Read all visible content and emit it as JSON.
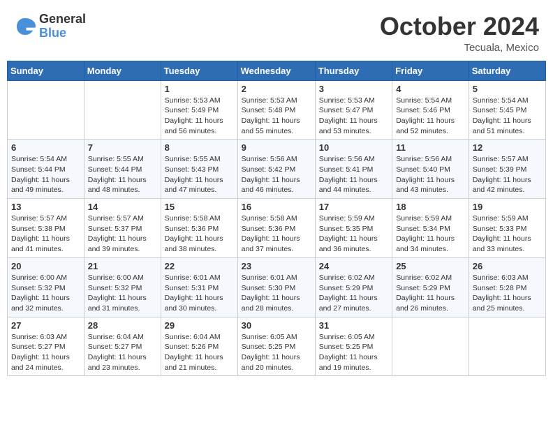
{
  "header": {
    "logo_line1": "General",
    "logo_line2": "Blue",
    "month": "October 2024",
    "location": "Tecuala, Mexico"
  },
  "weekdays": [
    "Sunday",
    "Monday",
    "Tuesday",
    "Wednesday",
    "Thursday",
    "Friday",
    "Saturday"
  ],
  "weeks": [
    [
      {
        "day": "",
        "info": ""
      },
      {
        "day": "",
        "info": ""
      },
      {
        "day": "1",
        "info": "Sunrise: 5:53 AM\nSunset: 5:49 PM\nDaylight: 11 hours and 56 minutes."
      },
      {
        "day": "2",
        "info": "Sunrise: 5:53 AM\nSunset: 5:48 PM\nDaylight: 11 hours and 55 minutes."
      },
      {
        "day": "3",
        "info": "Sunrise: 5:53 AM\nSunset: 5:47 PM\nDaylight: 11 hours and 53 minutes."
      },
      {
        "day": "4",
        "info": "Sunrise: 5:54 AM\nSunset: 5:46 PM\nDaylight: 11 hours and 52 minutes."
      },
      {
        "day": "5",
        "info": "Sunrise: 5:54 AM\nSunset: 5:45 PM\nDaylight: 11 hours and 51 minutes."
      }
    ],
    [
      {
        "day": "6",
        "info": "Sunrise: 5:54 AM\nSunset: 5:44 PM\nDaylight: 11 hours and 49 minutes."
      },
      {
        "day": "7",
        "info": "Sunrise: 5:55 AM\nSunset: 5:44 PM\nDaylight: 11 hours and 48 minutes."
      },
      {
        "day": "8",
        "info": "Sunrise: 5:55 AM\nSunset: 5:43 PM\nDaylight: 11 hours and 47 minutes."
      },
      {
        "day": "9",
        "info": "Sunrise: 5:56 AM\nSunset: 5:42 PM\nDaylight: 11 hours and 46 minutes."
      },
      {
        "day": "10",
        "info": "Sunrise: 5:56 AM\nSunset: 5:41 PM\nDaylight: 11 hours and 44 minutes."
      },
      {
        "day": "11",
        "info": "Sunrise: 5:56 AM\nSunset: 5:40 PM\nDaylight: 11 hours and 43 minutes."
      },
      {
        "day": "12",
        "info": "Sunrise: 5:57 AM\nSunset: 5:39 PM\nDaylight: 11 hours and 42 minutes."
      }
    ],
    [
      {
        "day": "13",
        "info": "Sunrise: 5:57 AM\nSunset: 5:38 PM\nDaylight: 11 hours and 41 minutes."
      },
      {
        "day": "14",
        "info": "Sunrise: 5:57 AM\nSunset: 5:37 PM\nDaylight: 11 hours and 39 minutes."
      },
      {
        "day": "15",
        "info": "Sunrise: 5:58 AM\nSunset: 5:36 PM\nDaylight: 11 hours and 38 minutes."
      },
      {
        "day": "16",
        "info": "Sunrise: 5:58 AM\nSunset: 5:36 PM\nDaylight: 11 hours and 37 minutes."
      },
      {
        "day": "17",
        "info": "Sunrise: 5:59 AM\nSunset: 5:35 PM\nDaylight: 11 hours and 36 minutes."
      },
      {
        "day": "18",
        "info": "Sunrise: 5:59 AM\nSunset: 5:34 PM\nDaylight: 11 hours and 34 minutes."
      },
      {
        "day": "19",
        "info": "Sunrise: 5:59 AM\nSunset: 5:33 PM\nDaylight: 11 hours and 33 minutes."
      }
    ],
    [
      {
        "day": "20",
        "info": "Sunrise: 6:00 AM\nSunset: 5:32 PM\nDaylight: 11 hours and 32 minutes."
      },
      {
        "day": "21",
        "info": "Sunrise: 6:00 AM\nSunset: 5:32 PM\nDaylight: 11 hours and 31 minutes."
      },
      {
        "day": "22",
        "info": "Sunrise: 6:01 AM\nSunset: 5:31 PM\nDaylight: 11 hours and 30 minutes."
      },
      {
        "day": "23",
        "info": "Sunrise: 6:01 AM\nSunset: 5:30 PM\nDaylight: 11 hours and 28 minutes."
      },
      {
        "day": "24",
        "info": "Sunrise: 6:02 AM\nSunset: 5:29 PM\nDaylight: 11 hours and 27 minutes."
      },
      {
        "day": "25",
        "info": "Sunrise: 6:02 AM\nSunset: 5:29 PM\nDaylight: 11 hours and 26 minutes."
      },
      {
        "day": "26",
        "info": "Sunrise: 6:03 AM\nSunset: 5:28 PM\nDaylight: 11 hours and 25 minutes."
      }
    ],
    [
      {
        "day": "27",
        "info": "Sunrise: 6:03 AM\nSunset: 5:27 PM\nDaylight: 11 hours and 24 minutes."
      },
      {
        "day": "28",
        "info": "Sunrise: 6:04 AM\nSunset: 5:27 PM\nDaylight: 11 hours and 23 minutes."
      },
      {
        "day": "29",
        "info": "Sunrise: 6:04 AM\nSunset: 5:26 PM\nDaylight: 11 hours and 21 minutes."
      },
      {
        "day": "30",
        "info": "Sunrise: 6:05 AM\nSunset: 5:25 PM\nDaylight: 11 hours and 20 minutes."
      },
      {
        "day": "31",
        "info": "Sunrise: 6:05 AM\nSunset: 5:25 PM\nDaylight: 11 hours and 19 minutes."
      },
      {
        "day": "",
        "info": ""
      },
      {
        "day": "",
        "info": ""
      }
    ]
  ]
}
